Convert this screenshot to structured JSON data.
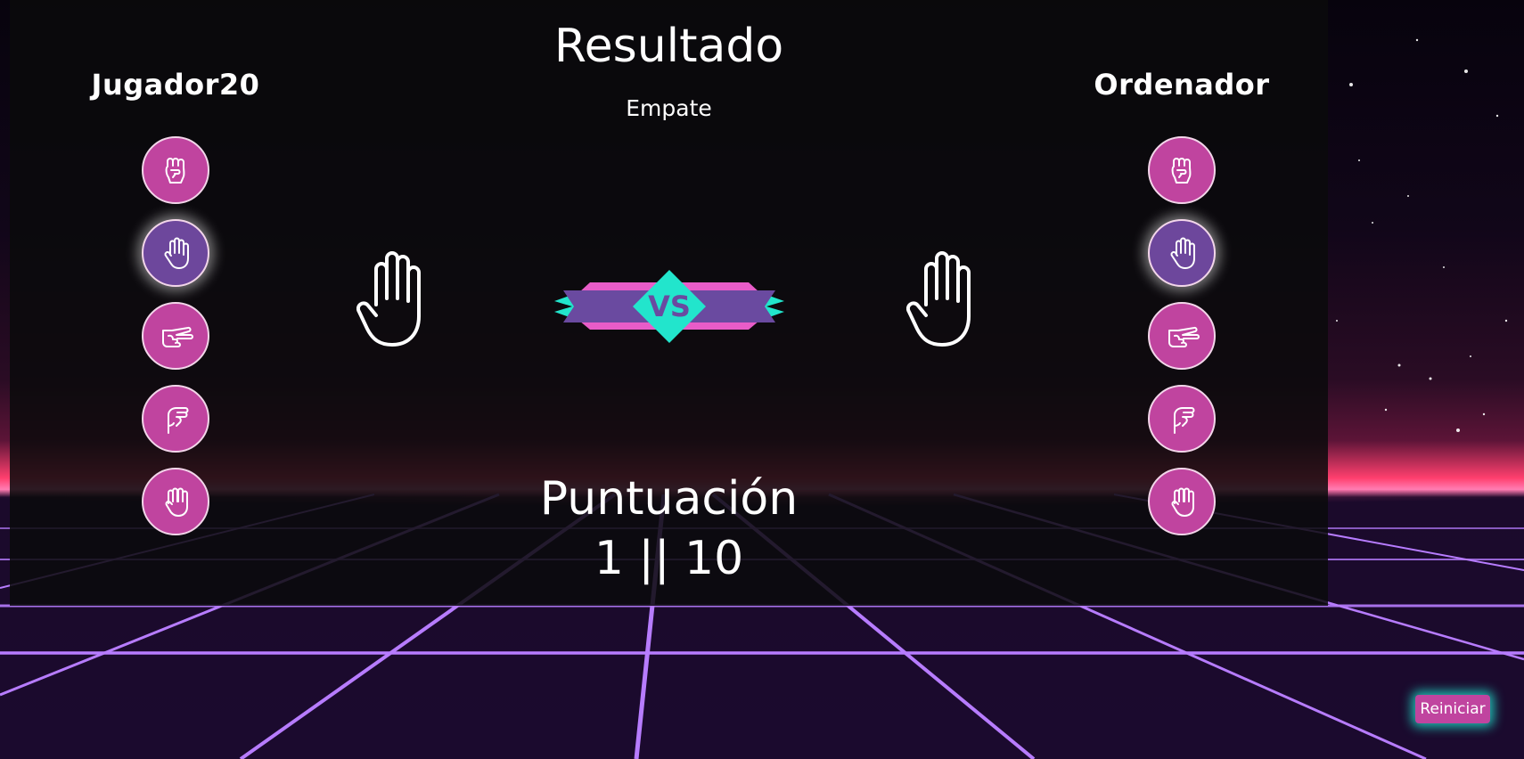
{
  "players": {
    "left": {
      "name": "Jugador20",
      "selected_index": 1
    },
    "right": {
      "name": "Ordenador",
      "selected_index": 1
    }
  },
  "choices": [
    {
      "icon": "rock-fist-icon"
    },
    {
      "icon": "paper-hand-icon"
    },
    {
      "icon": "scissors-hand-icon"
    },
    {
      "icon": "lizard-hand-icon"
    },
    {
      "icon": "spock-hand-icon"
    }
  ],
  "result": {
    "title": "Resultado",
    "text": "Empate",
    "left_hand_icon": "paper-hand-icon",
    "right_hand_icon": "paper-hand-icon",
    "vs_label": "VS"
  },
  "score": {
    "title": "Puntuación",
    "line": "1 || 10"
  },
  "restart_label": "Reiniciar",
  "colors": {
    "choice_button": "#c0449f",
    "choice_selected": "#6d479c",
    "vs_teal": "#22e5cc",
    "vs_purple": "#6a4aa0",
    "vs_pink": "#e85cc8",
    "grid_line": "#b77cff"
  }
}
